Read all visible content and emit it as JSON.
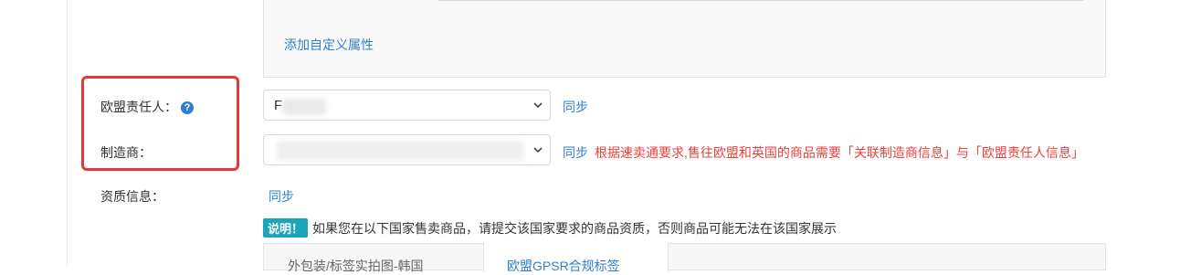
{
  "custom_attr": {
    "add_label": "添加自定义属性"
  },
  "eu_rep": {
    "label": "欧盟责任人：",
    "help_glyph": "?",
    "selected_value": "F",
    "sync_label": "同步"
  },
  "manufacturer": {
    "label": "制造商：",
    "selected_value": "",
    "sync_label": "同步",
    "warning": "根据速卖通要求,售往欧盟和英国的商品需要「关联制造商信息」与「欧盟责任人信息」"
  },
  "qualification": {
    "label": "资质信息：",
    "sync_label": "同步",
    "note_badge": "说明！",
    "note_text": "如果您在以下国家售卖商品，请提交该国家要求的商品资质，否则商品可能无法在该国家展示"
  },
  "tabs": [
    {
      "label": "外包装/标签实拍图-韩国",
      "active": false
    },
    {
      "label": "欧盟GPSR合规标签",
      "active": true
    }
  ],
  "colors": {
    "link": "#2f7fd1",
    "warning": "#e8413c",
    "highlight": "#e53935",
    "badge": "#1aa5b8"
  }
}
